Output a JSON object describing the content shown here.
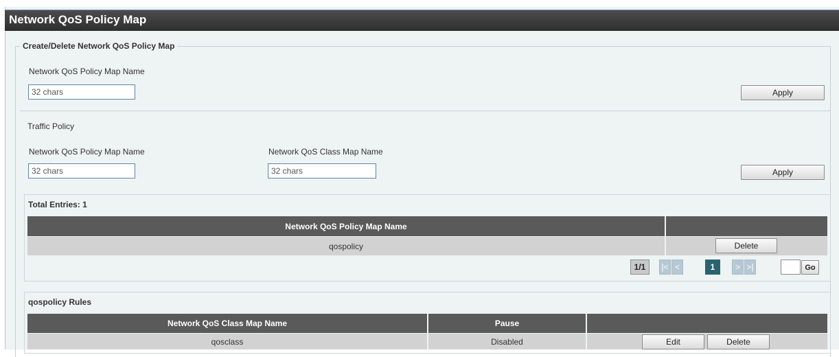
{
  "page": {
    "title": "Network QoS Policy Map"
  },
  "create_section": {
    "legend": "Create/Delete Network QoS Policy Map",
    "name_label": "Network QoS Policy Map Name",
    "name_placeholder": "32 chars",
    "apply_label": "Apply"
  },
  "traffic_policy": {
    "heading": "Traffic Policy",
    "policy_label": "Network QoS Policy Map Name",
    "policy_placeholder": "32 chars",
    "class_label": "Network QoS Class Map Name",
    "class_placeholder": "32 chars",
    "apply_label": "Apply"
  },
  "policy_table": {
    "total_entries": "Total Entries: 1",
    "columns": [
      "Network QoS Policy Map Name",
      ""
    ],
    "rows": [
      {
        "name": "qospolicy",
        "delete_label": "Delete"
      }
    ],
    "pagination": {
      "page_info": "1/1",
      "first": "|<",
      "prev": "<",
      "current": "1",
      "next": ">",
      "last": ">|",
      "go_label": "Go",
      "go_value": ""
    }
  },
  "rules_table": {
    "heading": "qospolicy Rules",
    "columns": [
      "Network QoS Class Map Name",
      "Pause",
      ""
    ],
    "rows": [
      {
        "class_name": "qosclass",
        "pause": "Disabled",
        "edit_label": "Edit",
        "delete_label": "Delete"
      }
    ]
  },
  "colors": {
    "title_bar": "#3a3a3a",
    "header_row": "#5a5a5a",
    "data_row": "#d2d2d2",
    "active_page": "#29636f",
    "background": "#eef3f3"
  }
}
